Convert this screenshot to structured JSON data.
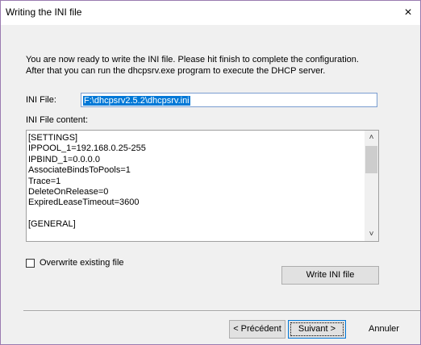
{
  "window": {
    "title": "Writing the INI file",
    "close_glyph": "×"
  },
  "intro": {
    "line1": "You are now ready to write the INI file. Please hit finish to complete the configuration.",
    "line2": "After that you can run the dhcpsrv.exe program to execute the DHCP server."
  },
  "ini_file": {
    "label": "INI File:",
    "value": "F:\\dhcpsrv2.5.2\\dhcpsrv.ini"
  },
  "content": {
    "label": "INI File content:",
    "lines": [
      "[SETTINGS]",
      "IPPOOL_1=192.168.0.25-255",
      "IPBIND_1=0.0.0.0",
      "AssociateBindsToPools=1",
      "Trace=1",
      "DeleteOnRelease=0",
      "ExpiredLeaseTimeout=3600",
      "",
      "[GENERAL]"
    ],
    "scroll_up_icon": "chevron-up-icon",
    "scroll_down_icon": "chevron-down-icon"
  },
  "overwrite": {
    "label": "Overwrite existing file",
    "checked": false
  },
  "buttons": {
    "write": "Write INI file",
    "previous": "< Précédent",
    "next": "Suivant >",
    "cancel": "Annuler"
  },
  "colors": {
    "selection": "#0078d7",
    "window_border": "#9a7bb0"
  }
}
